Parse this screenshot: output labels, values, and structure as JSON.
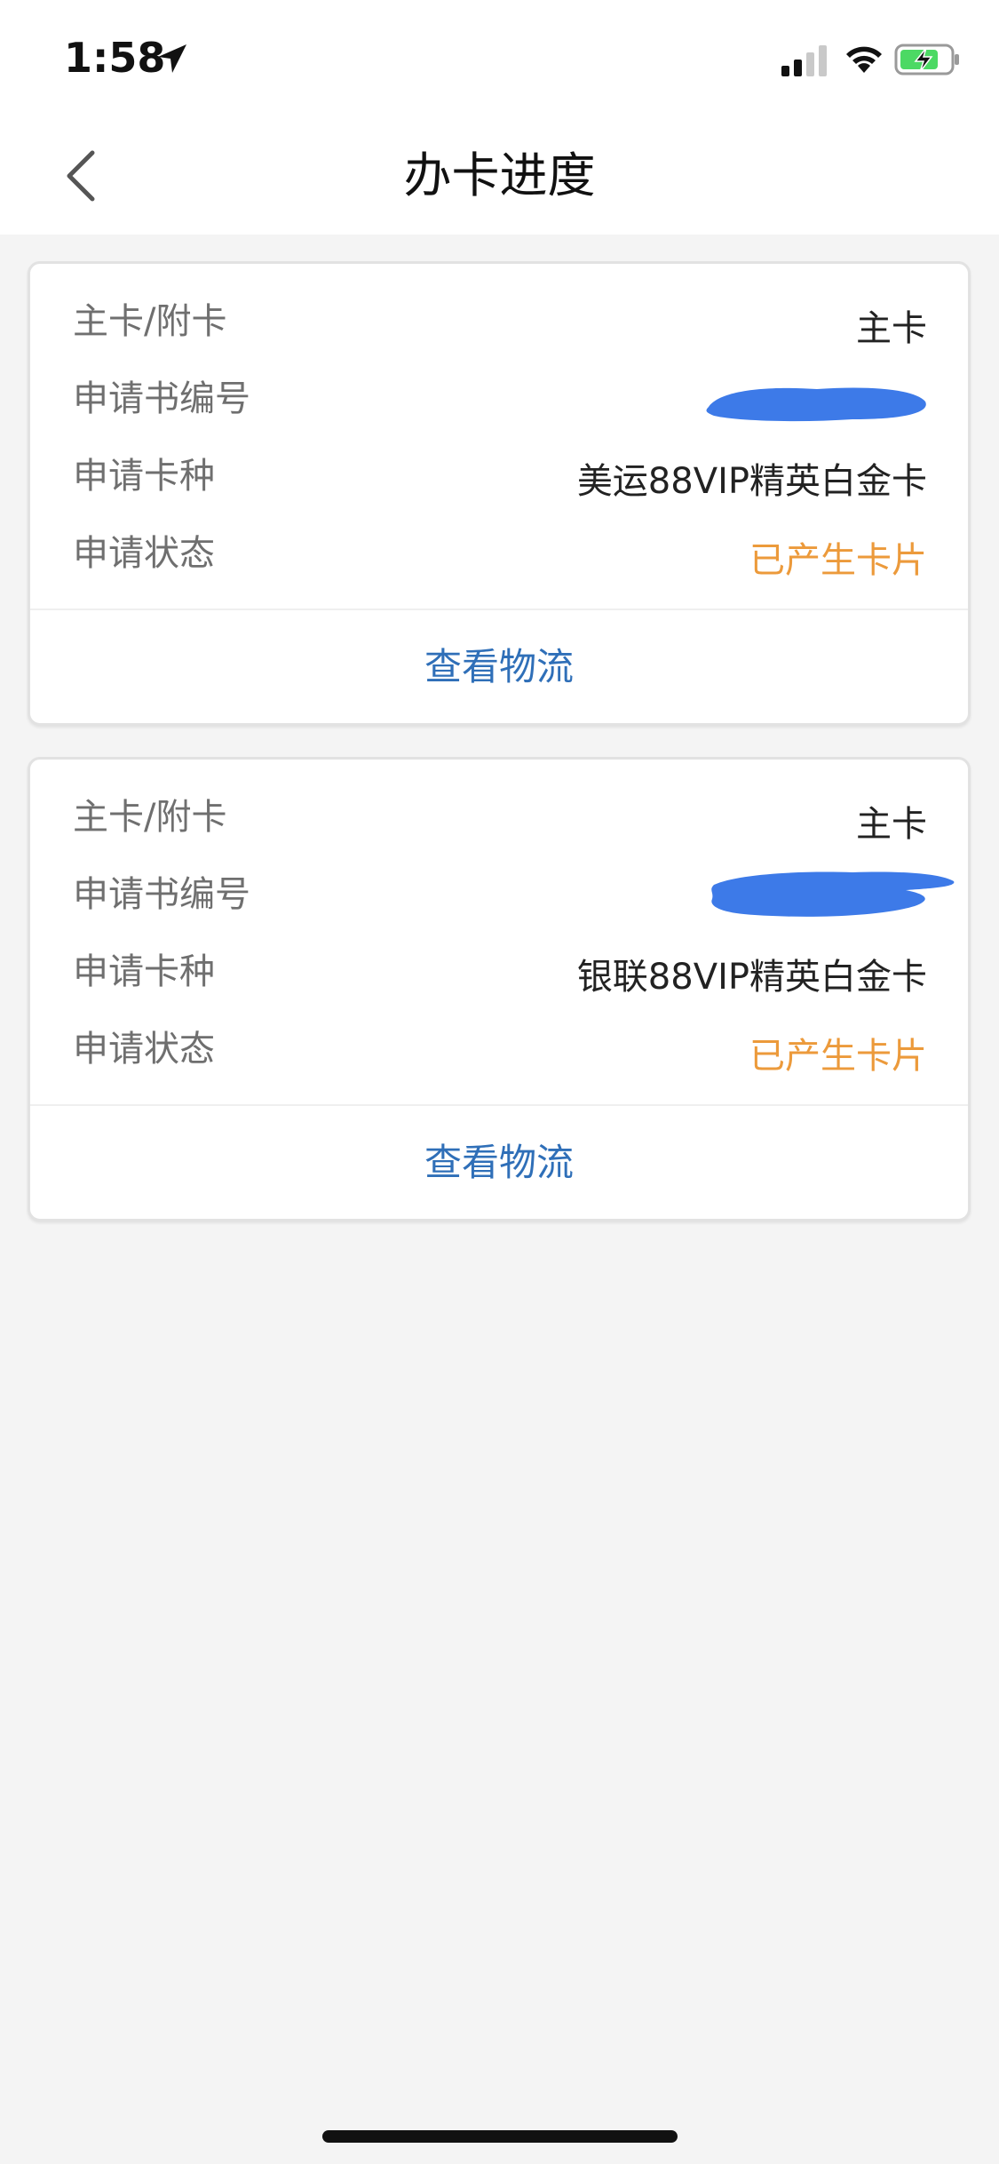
{
  "status_bar": {
    "time": "1:58",
    "location_icon": "location-arrow-icon",
    "signal_icon": "cellular-signal-icon",
    "wifi_icon": "wifi-icon",
    "battery_icon": "battery-charging-icon"
  },
  "nav": {
    "back_icon": "chevron-left-icon",
    "title": "办卡进度"
  },
  "cards": [
    {
      "rows": [
        {
          "label": "主卡/附卡",
          "value": "主卡"
        },
        {
          "label": "申请书编号",
          "value": "",
          "redacted": true
        },
        {
          "label": "申请卡种",
          "value": "美运88VIP精英白金卡"
        },
        {
          "label": "申请状态",
          "value": "已产生卡片"
        }
      ],
      "action_label": "查看物流"
    },
    {
      "rows": [
        {
          "label": "主卡/附卡",
          "value": "主卡"
        },
        {
          "label": "申请书编号",
          "value": "",
          "redacted": true
        },
        {
          "label": "申请卡种",
          "value": "银联88VIP精英白金卡"
        },
        {
          "label": "申请状态",
          "value": "已产生卡片"
        }
      ],
      "action_label": "查看物流"
    }
  ],
  "colors": {
    "status_text": "#ec9a3b",
    "link": "#2f6fb8",
    "redaction": "#3d7ae8",
    "page_bg": "#f4f4f4"
  }
}
